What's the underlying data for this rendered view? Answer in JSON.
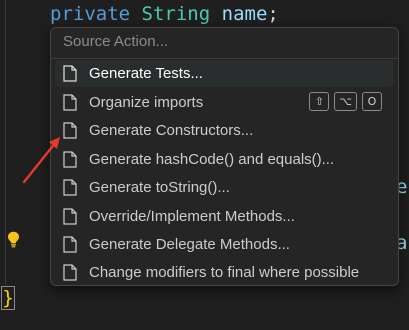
{
  "code": {
    "keyword": "private",
    "type": "String",
    "identifier": "name",
    "semicolon": ";",
    "peek_right_1": "e",
    "peek_right_2": "a",
    "closing_brace": "}"
  },
  "menu": {
    "header": "Source Action...",
    "items": [
      {
        "label": "Generate Tests...",
        "selected": true
      },
      {
        "label": "Organize imports",
        "keys": [
          "⇧",
          "⌥",
          "O"
        ]
      },
      {
        "label": "Generate Constructors..."
      },
      {
        "label": "Generate hashCode() and equals()..."
      },
      {
        "label": "Generate toString()..."
      },
      {
        "label": "Override/Implement Methods..."
      },
      {
        "label": "Generate Delegate Methods..."
      },
      {
        "label": "Change modifiers to final where possible"
      }
    ]
  },
  "colors": {
    "keyword": "#569cd6",
    "type": "#4ec9b0",
    "identifier": "#9cdcfe",
    "annotation_arrow": "#e23b2e",
    "bulb": "#f5c518"
  },
  "icons": {
    "item_icon": "file-icon",
    "gutter_icon": "lightbulb-icon"
  }
}
